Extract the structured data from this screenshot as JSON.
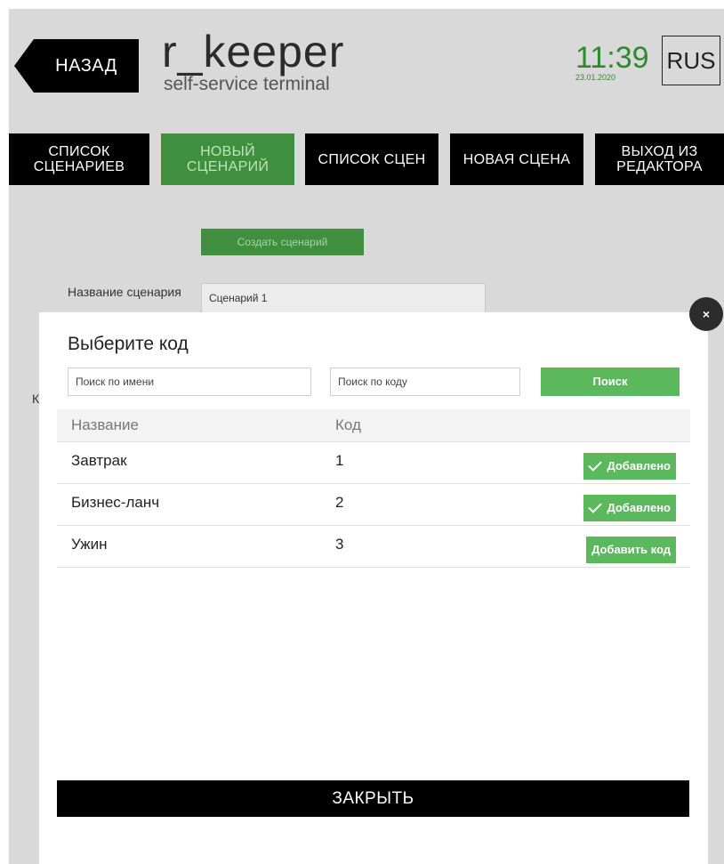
{
  "header": {
    "back_label": "НАЗАД",
    "logo_main": "r_keeper",
    "logo_sub": "self-service terminal",
    "time": "11:39",
    "date": "23.01.2020",
    "language": "RUS"
  },
  "nav": {
    "items": [
      {
        "label": "СПИСОК СЦЕНАРИЕВ",
        "active": false
      },
      {
        "label": "НОВЫЙ СЦЕНАРИЙ",
        "active": true
      },
      {
        "label": "СПИСОК СЦЕН",
        "active": false
      },
      {
        "label": "НОВАЯ СЦЕНА",
        "active": false
      },
      {
        "label": "ВЫХОД ИЗ РЕДАКТОРА",
        "active": false
      }
    ]
  },
  "editor": {
    "create_button": "Создать сценарий",
    "name_label": "Название сценария",
    "name_value": "Сценарий 1",
    "peek_label": "К"
  },
  "modal": {
    "close_icon": "×",
    "title": "Выберите код",
    "search_name_placeholder": "Поиск по имени",
    "search_code_placeholder": "Поиск по коду",
    "search_button": "Поиск",
    "columns": {
      "name": "Название",
      "code": "Код"
    },
    "rows": [
      {
        "name": "Завтрак",
        "code": "1",
        "action": "Добавлено",
        "added": true
      },
      {
        "name": "Бизнес-ланч",
        "code": "2",
        "action": "Добавлено",
        "added": true
      },
      {
        "name": "Ужин",
        "code": "3",
        "action": "Добавить код",
        "added": false
      }
    ],
    "close_button": "ЗАКРЫТЬ"
  },
  "colors": {
    "accent_green": "#5cb85c",
    "dark_green": "#3f8f3f",
    "clock_green": "#2e8a2e",
    "background": "#d9d9d9"
  }
}
